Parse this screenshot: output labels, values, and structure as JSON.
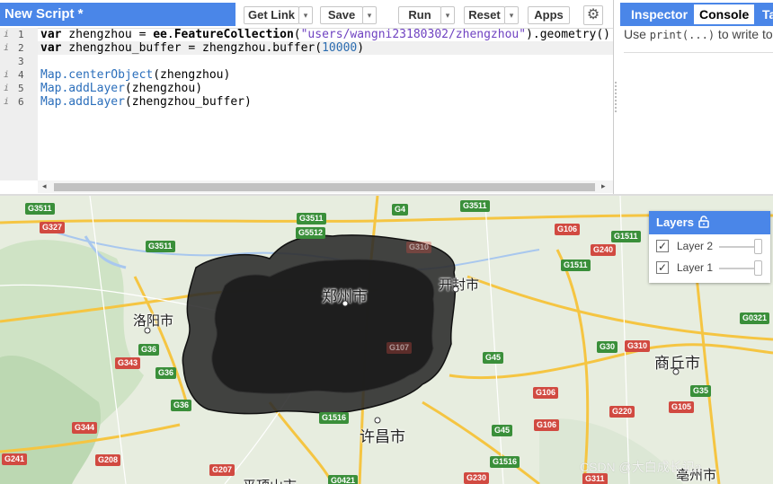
{
  "editor": {
    "script_title": "New Script *",
    "buttons": {
      "get_link": "Get Link",
      "save": "Save",
      "run": "Run",
      "reset": "Reset",
      "apps": "Apps"
    },
    "dropdown_glyph": "▾",
    "settings_glyph": "⚙",
    "gutter": [
      {
        "info": "i",
        "num": "1"
      },
      {
        "info": "i",
        "num": "2"
      },
      {
        "info": "",
        "num": "3"
      },
      {
        "info": "i",
        "num": "4"
      },
      {
        "info": "i",
        "num": "5"
      },
      {
        "info": "i",
        "num": "6"
      }
    ],
    "code": {
      "l1": {
        "kw": "var",
        "rest1": " zhengzhou = ",
        "ns": "ee",
        "rest2": ".",
        "fn": "FeatureCollection",
        "p1": "(",
        "str": "\"users/wangni23180302/zhengzhou\"",
        "p2": ").",
        "fn2": "geometry",
        "p3": "()"
      },
      "l2": {
        "kw": "var",
        "rest1": " zhengzhou_buffer = zhengzhou.",
        "fn": "buffer",
        "p1": "(",
        "num": "10000",
        "p2": ")"
      },
      "l4": {
        "fn": "Map.centerObject",
        "arg": "(zhengzhou)"
      },
      "l5": {
        "fn": "Map.addLayer",
        "arg": "(zhengzhou)"
      },
      "l6": {
        "fn": "Map.addLayer",
        "arg": "(zhengzhou_buffer)"
      }
    },
    "scroll_left": "◂",
    "scroll_right": "▸"
  },
  "console": {
    "tabs": [
      "Inspector",
      "Console",
      "Ta"
    ],
    "active_tab": "Console",
    "hint_pre": "Use ",
    "hint_code": "print(...)",
    "hint_post": " to write to"
  },
  "map": {
    "cities": [
      {
        "name": "郑州市",
        "big": true
      },
      {
        "name": "开封市"
      },
      {
        "name": "洛阳市"
      },
      {
        "name": "商丘市"
      },
      {
        "name": "许昌市",
        "big": true
      },
      {
        "name": "平顶山市"
      },
      {
        "name": "亳州市"
      }
    ],
    "shields": [
      "G3511",
      "G327",
      "G3511",
      "G4",
      "G3511",
      "G5512",
      "G3511",
      "G106",
      "G240",
      "G1511",
      "G1511",
      "G0321",
      "G36",
      "G36",
      "G343",
      "G36",
      "G30",
      "G310",
      "G45",
      "G106",
      "G105",
      "G35",
      "G106",
      "G220",
      "G1516",
      "G344",
      "G45",
      "G1516",
      "G208",
      "G241",
      "G207",
      "G311",
      "G230",
      "G0421",
      "G105",
      "G4",
      "G310",
      "G107"
    ],
    "layers": {
      "title": "Layers",
      "items": [
        {
          "name": "Layer 2",
          "checked": true
        },
        {
          "name": "Layer 1",
          "checked": true
        }
      ]
    },
    "watermark": "CSDN @大白成长记a",
    "colors": {
      "buffer_fill": "#000000",
      "accent": "#4a86e8",
      "road": "#f5c542"
    }
  }
}
